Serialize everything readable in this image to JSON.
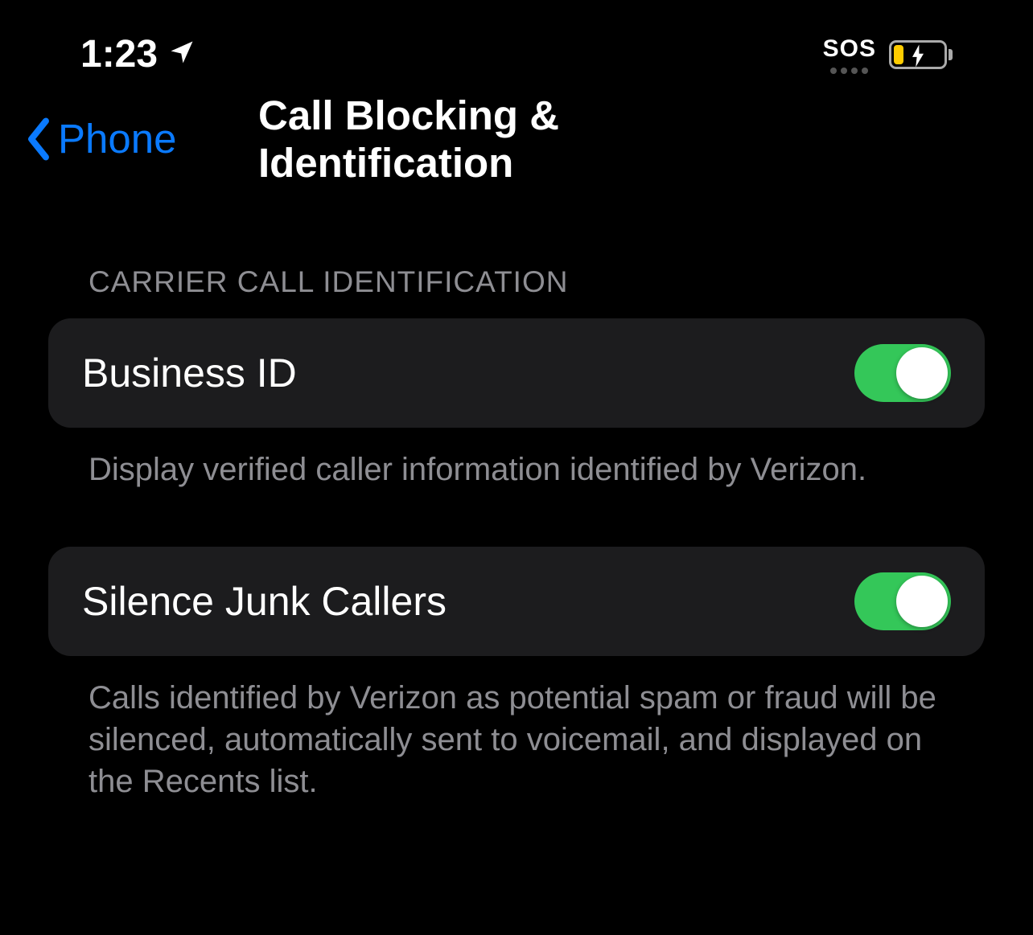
{
  "status": {
    "time": "1:23",
    "sos_label": "SOS"
  },
  "nav": {
    "back_label": "Phone",
    "title": "Call Blocking & Identification"
  },
  "sections": {
    "carrier": {
      "header": "Carrier Call Identification",
      "business_id": {
        "label": "Business ID",
        "footer": "Display verified caller information identified by Verizon.",
        "on": true
      },
      "silence_junk": {
        "label": "Silence Junk Callers",
        "footer": "Calls identified by Verizon as potential spam or fraud will be silenced, automatically sent to voicemail, and displayed on the Recents list.",
        "on": true
      }
    }
  },
  "colors": {
    "accent": "#0a7aff",
    "toggle_on": "#34c759",
    "cell_bg": "#1c1c1e",
    "secondary_text": "#8e8e93"
  }
}
